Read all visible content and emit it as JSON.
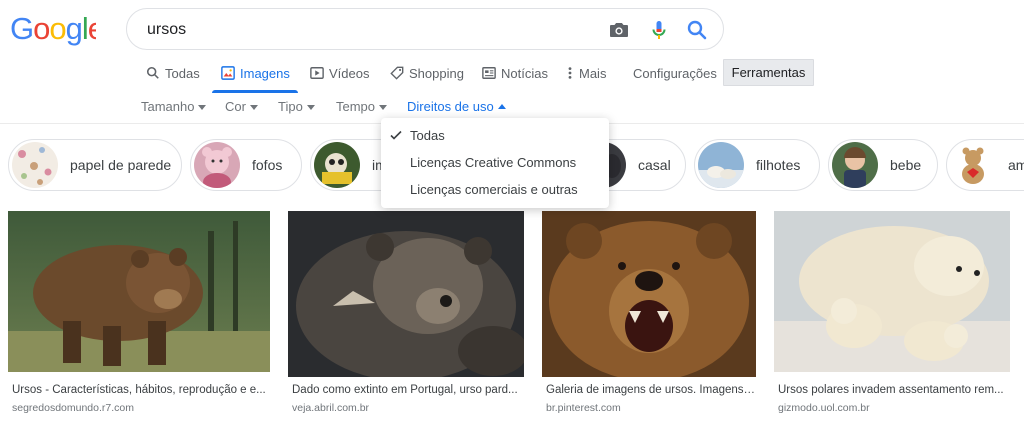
{
  "logo": {
    "text": "Google"
  },
  "search": {
    "query": "ursos"
  },
  "tabs": [
    {
      "label": "Todas",
      "icon": "search-icon"
    },
    {
      "label": "Imagens",
      "icon": "image-icon",
      "active": true
    },
    {
      "label": "Vídeos",
      "icon": "video-icon"
    },
    {
      "label": "Shopping",
      "icon": "tag-icon"
    },
    {
      "label": "Notícias",
      "icon": "news-icon"
    },
    {
      "label": "Mais",
      "icon": "more-vert-icon"
    },
    {
      "label": "Configurações"
    }
  ],
  "tools_label": "Ferramentas",
  "filters": [
    {
      "label": "Tamanho"
    },
    {
      "label": "Cor"
    },
    {
      "label": "Tipo"
    },
    {
      "label": "Tempo"
    },
    {
      "label": "Direitos de uso",
      "active": true
    }
  ],
  "dropdown": {
    "items": [
      {
        "label": "Todas",
        "checked": true
      },
      {
        "label": "Licenças Creative Commons"
      },
      {
        "label": "Licenças comerciais e outras"
      }
    ]
  },
  "chips": [
    {
      "label": "papel de parede"
    },
    {
      "label": "fofos"
    },
    {
      "label": "im"
    },
    {
      "label": "casal"
    },
    {
      "label": "filhotes"
    },
    {
      "label": "bebe"
    },
    {
      "label": "am"
    }
  ],
  "results": [
    {
      "title": "Ursos - Características, hábitos, reprodução e e...",
      "source": "segredosdomundo.r7.com"
    },
    {
      "title": "Dado como extinto em Portugal, urso pard...",
      "source": "veja.abril.com.br"
    },
    {
      "title": "Galeria de imagens de ursos. Imagens ...",
      "source": "br.pinterest.com"
    },
    {
      "title": "Ursos polares invadem assentamento rem...",
      "source": "gizmodo.uol.com.br"
    }
  ],
  "colors": {
    "accent": "#1a73e8",
    "google_blue": "#4285f4",
    "google_red": "#ea4335",
    "google_yellow": "#fbbc05",
    "google_green": "#34a853"
  }
}
